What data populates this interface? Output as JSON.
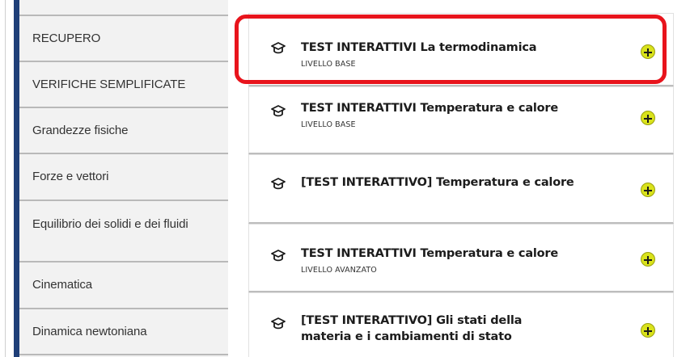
{
  "sidebar": {
    "items": [
      {
        "label": "RECUPERO"
      },
      {
        "label": "VERIFICHE SEMPLIFICATE"
      },
      {
        "label": "Grandezze fisiche"
      },
      {
        "label": "Forze e vettori"
      },
      {
        "label": "Equilibrio dei solidi e dei fluidi"
      },
      {
        "label": "Cinematica"
      },
      {
        "label": "Dinamica newtoniana"
      }
    ]
  },
  "cards": [
    {
      "title": "TEST INTERATTIVI La termodinamica",
      "level": "LIVELLO BASE",
      "icon": "graduation-cap-icon",
      "action_icon": "plus-icon",
      "highlighted": true
    },
    {
      "title": "TEST INTERATTIVI Temperatura e calore",
      "level": "LIVELLO BASE",
      "icon": "graduation-cap-icon",
      "action_icon": "plus-icon"
    },
    {
      "title": "[TEST INTERATTIVO] Temperatura e calore",
      "level": "",
      "icon": "graduation-cap-icon",
      "action_icon": "plus-icon"
    },
    {
      "title": "TEST INTERATTIVI Temperatura e calore",
      "level": "LIVELLO AVANZATO",
      "icon": "graduation-cap-icon",
      "action_icon": "plus-icon"
    },
    {
      "title": "[TEST INTERATTIVO] Gli stati della materia e i cambiamenti di stato",
      "level": "",
      "icon": "graduation-cap-icon",
      "action_icon": "plus-icon"
    }
  ],
  "colors": {
    "sidebar_accent": "#1f3f78",
    "plus_button": "#d9e21b",
    "highlight_border": "#e8141c"
  }
}
